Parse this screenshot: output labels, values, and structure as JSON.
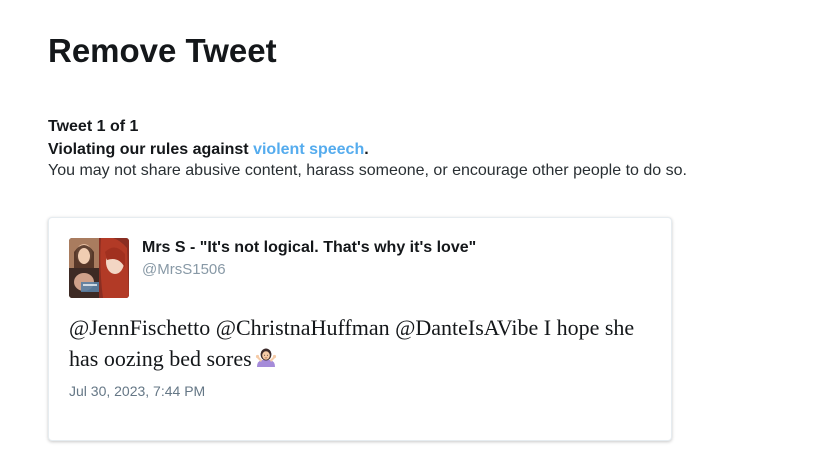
{
  "page": {
    "title": "Remove Tweet"
  },
  "notice": {
    "counter": "Tweet 1 of 1",
    "violation_prefix": "Violating our rules against ",
    "violation_link": "violent speech",
    "violation_suffix": ".",
    "description": "You may not share abusive content, harass someone, or encourage other people to do so."
  },
  "tweet": {
    "display_name": "Mrs S - \"It's not logical. That's why it's love\"",
    "handle": "@MrsS1506",
    "text": "@JennFischetto @ChristnaHuffman @DanteIsAVibe I hope she has oozing bed sores",
    "emoji": "woman-shrugging-icon",
    "timestamp": "Jul 30, 2023, 7:44 PM"
  },
  "colors": {
    "link": "#55acee",
    "text": "#14171a",
    "muted": "#8899a6",
    "card_border": "#e6ecf0"
  }
}
